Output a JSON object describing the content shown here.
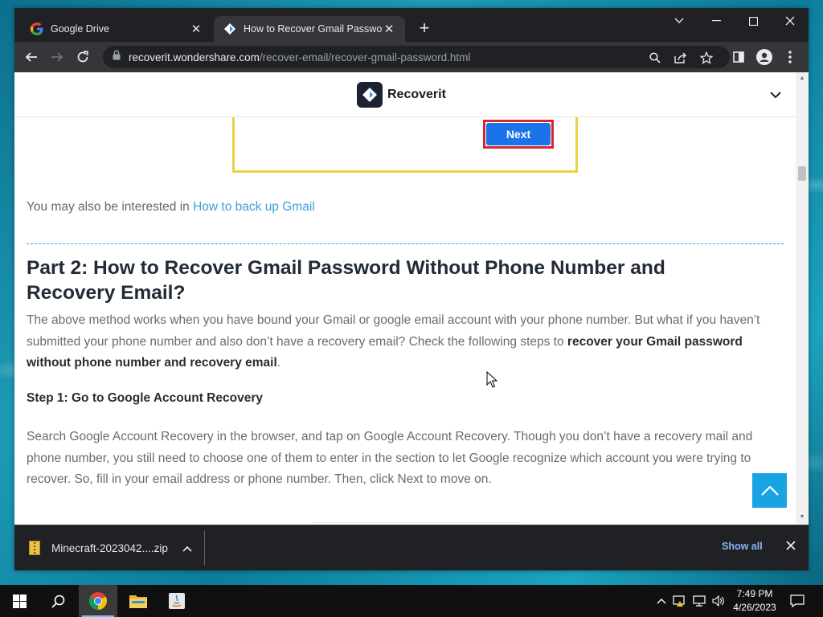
{
  "browser": {
    "tabs": [
      {
        "title": "Google Drive",
        "favicon": "google-icon",
        "active": false
      },
      {
        "title": "How to Recover Gmail Password",
        "favicon": "recoverit-icon",
        "active": true
      }
    ],
    "url_host": "recoverit.wondershare.com",
    "url_path": "/recover-email/recover-gmail-password.html"
  },
  "site": {
    "brand": "Recoverit"
  },
  "screenshot": {
    "next_label": "Next"
  },
  "article": {
    "interest_prefix": "You may also be interested in ",
    "interest_link": "How to back up Gmail",
    "heading": "Part 2: How to Recover Gmail Password Without Phone Number and Recovery Email?",
    "p1_text": "The above method works when you have bound your Gmail or google email account with your phone number. But what if you haven’t submitted your phone number and also don’t have a recovery email? Check the following steps to ",
    "p1_bold": "recover your Gmail password without phone number and recovery email",
    "p1_end": ".",
    "step1": "Step 1: Go to Google Account Recovery",
    "p2": "Search Google Account Recovery in the browser, and tap on Google Account Recovery. Though you don’t have a recovery mail and phone number, you still need to choose one of them to enter in the section to let Google recognize which account you were trying to recover. So, fill in your email address or phone number. Then, click Next to move on."
  },
  "downloads": {
    "filename": "Minecraft-2023042....zip",
    "show_all": "Show all"
  },
  "taskbar": {
    "time": "7:49 PM",
    "date": "4/26/2023"
  },
  "colors": {
    "link": "#3aa0d6",
    "next_button": "#1a73e8",
    "highlight_border": "#d8262f",
    "screenshot_border": "#ecd142",
    "to_top": "#18a3e3"
  }
}
